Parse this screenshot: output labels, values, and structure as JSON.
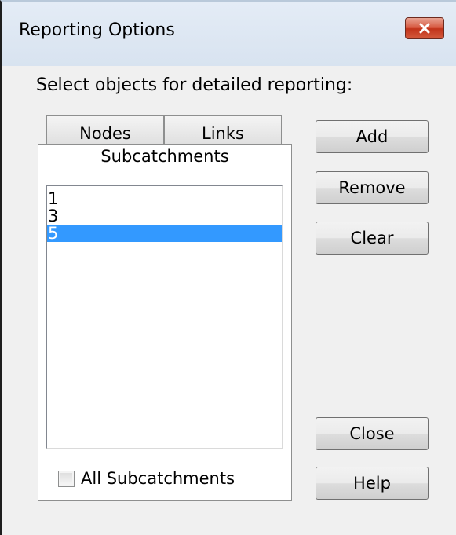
{
  "window": {
    "title": "Reporting Options",
    "close_icon": "close-icon"
  },
  "instruction": "Select objects for detailed reporting:",
  "tabs": [
    {
      "label": "Nodes",
      "active": false
    },
    {
      "label": "Links",
      "active": false
    },
    {
      "label": "Subcatchments",
      "active": true
    }
  ],
  "list": {
    "items": [
      "1",
      "3",
      "5"
    ],
    "selected_index": 2
  },
  "checkbox": {
    "label": "All Subcatchments",
    "checked": false
  },
  "buttons": {
    "add": "Add",
    "remove": "Remove",
    "clear": "Clear",
    "close": "Close",
    "help": "Help"
  },
  "colors": {
    "selection": "#3399ff",
    "close_button": "#c7432a",
    "dialog_background": "#f0f0f0"
  }
}
